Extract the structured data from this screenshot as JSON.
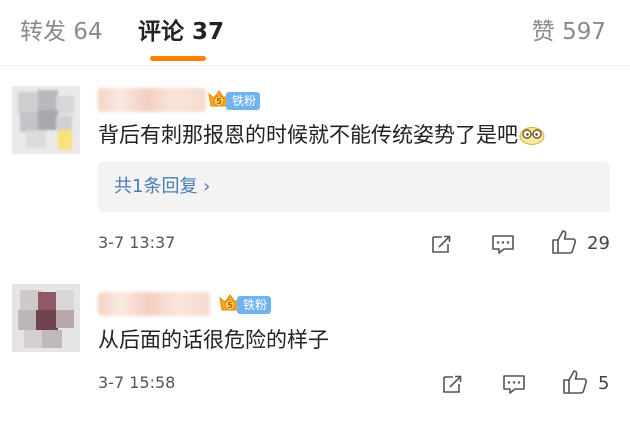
{
  "tabs": {
    "repost": "转发 64",
    "comment": "评论 37",
    "like": "赞 597"
  },
  "comments": [
    {
      "badge": "铁粉",
      "badge_level": "5",
      "text": "背后有刺那报恩的时候就不能传统姿势了是吧",
      "emoji": "doge-glasses-emoji",
      "reply_summary": "共1条回复 ›",
      "time": "3-7 13:37",
      "likes": "29"
    },
    {
      "badge": "铁粉",
      "badge_level": "5",
      "text": "从后面的话很危险的样子",
      "time": "3-7 15:58",
      "likes": "5"
    }
  ],
  "colors": {
    "accent": "#ff8200",
    "link": "#4a7bb3",
    "badge": "#6fb3f0",
    "crown": "#f5a623"
  }
}
